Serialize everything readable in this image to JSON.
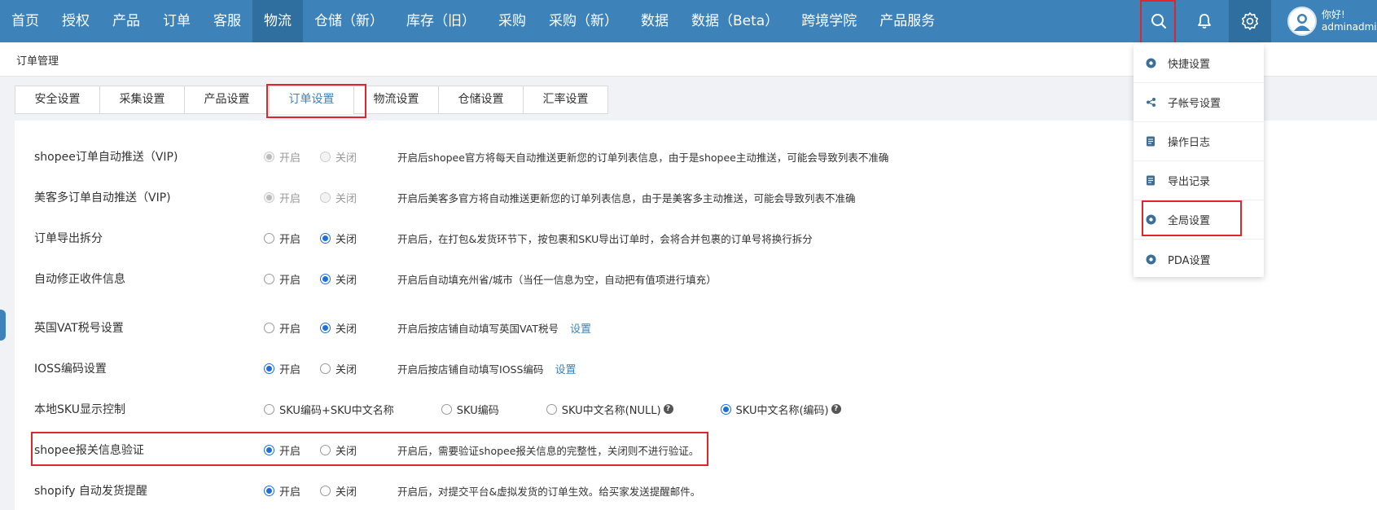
{
  "nav": {
    "items": [
      "首页",
      "授权",
      "产品",
      "订单",
      "客服",
      "物流",
      "仓储（新）",
      "库存（旧）",
      "采购",
      "采购（新）",
      "数据",
      "数据（Beta）",
      "跨境学院",
      "产品服务"
    ],
    "active_index": 5,
    "user_greeting": "你好!",
    "user_name": "adminadmin"
  },
  "breadcrumb": "订单管理",
  "tabs": [
    "安全设置",
    "采集设置",
    "产品设置",
    "订单设置",
    "物流设置",
    "仓储设置",
    "汇率设置"
  ],
  "active_tab": 3,
  "settings": [
    {
      "label": "shopee订单自动推送（VIP)",
      "opt_on": "开启",
      "opt_off": "关闭",
      "selected": "on",
      "disabled": true,
      "desc": "开启后shopee官方将每天自动推送更新您的订单列表信息，由于是shopee主动推送，可能会导致列表不准确"
    },
    {
      "label": "美客多订单自动推送（VIP)",
      "opt_on": "开启",
      "opt_off": "关闭",
      "selected": "on",
      "disabled": true,
      "desc": "开启后美客多官方将自动推送更新您的订单列表信息，由于是美客多主动推送，可能会导致列表不准确"
    },
    {
      "label": "订单导出拆分",
      "opt_on": "开启",
      "opt_off": "关闭",
      "selected": "off",
      "desc": "开启后，在打包&发货环节下，按包裹和SKU导出订单时，会将合并包裹的订单号将换行拆分"
    },
    {
      "label": "自动修正收件信息",
      "opt_on": "开启",
      "opt_off": "关闭",
      "selected": "off",
      "desc": "开启后自动填充州省/城市（当任一信息为空，自动把有值项进行填充）"
    },
    {
      "label": "英国VAT税号设置",
      "opt_on": "开启",
      "opt_off": "关闭",
      "selected": "off",
      "desc": "开启后按店铺自动填写英国VAT税号",
      "link": "设置"
    },
    {
      "label": "IOSS编码设置",
      "opt_on": "开启",
      "opt_off": "关闭",
      "selected": "on",
      "desc": "开启后按店铺自动填写IOSS编码",
      "link": "设置"
    },
    {
      "label": "shopee报关信息验证",
      "opt_on": "开启",
      "opt_off": "关闭",
      "selected": "on",
      "desc": "开启后，需要验证shopee报关信息的完整性，关闭则不进行验证。"
    },
    {
      "label": "shopify 自动发货提醒",
      "opt_on": "开启",
      "opt_off": "关闭",
      "selected": "on",
      "desc": "开启后，对提交平台&虚拟发货的订单生效。给买家发送提醒邮件。"
    }
  ],
  "sku_display": {
    "label": "本地SKU显示控制",
    "options": [
      "SKU编码+SKU中文名称",
      "SKU编码",
      "SKU中文名称(NULL)",
      "SKU中文名称(编码)"
    ],
    "selected_index": 3,
    "help_on": [
      2,
      3
    ]
  },
  "dropdown": {
    "items": [
      {
        "label": "快捷设置",
        "icon": "gear-icon"
      },
      {
        "label": "子帐号设置",
        "icon": "share-icon"
      },
      {
        "label": "操作日志",
        "icon": "document-icon"
      },
      {
        "label": "导出记录",
        "icon": "document-icon"
      },
      {
        "label": "全局设置",
        "icon": "gear-icon"
      },
      {
        "label": "PDA设置",
        "icon": "gear-icon"
      }
    ]
  },
  "colors": {
    "nav_bg": "#3d82b8",
    "nav_active": "#2f6f9f",
    "accent": "#1e6fd9",
    "highlight": "#e0262d"
  }
}
